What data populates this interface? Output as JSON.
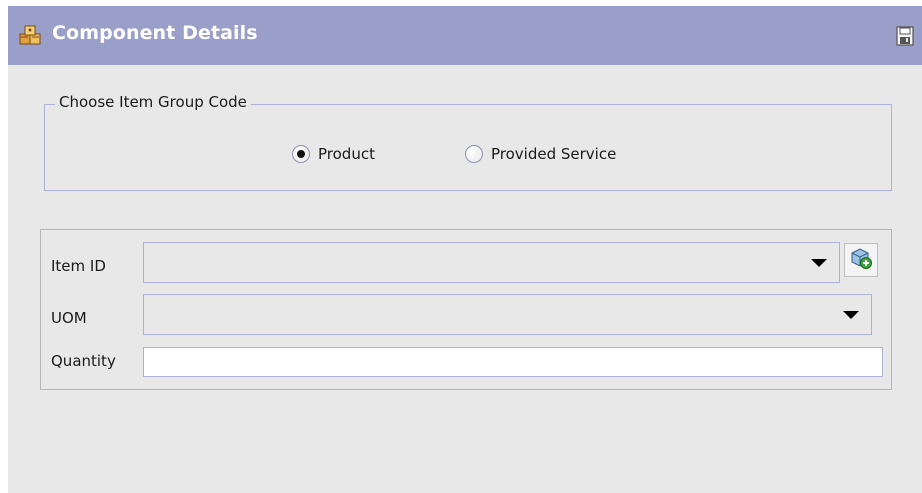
{
  "window": {
    "title": "Component Details",
    "title_icon": "components-icon",
    "save_icon": "save-icon"
  },
  "item_group": {
    "legend": "Choose Item Group Code",
    "options": [
      {
        "label": "Product",
        "selected": true
      },
      {
        "label": "Provided Service",
        "selected": false
      }
    ]
  },
  "fields": {
    "item_id": {
      "label": "Item ID",
      "value": "",
      "lookup_icon": "lookup-item-icon"
    },
    "uom": {
      "label": "UOM",
      "value": ""
    },
    "quantity": {
      "label": "Quantity",
      "value": ""
    }
  },
  "colors": {
    "titlebar": "#9a9fca",
    "background": "#e8e8e8",
    "border": "#aeb2d4"
  }
}
